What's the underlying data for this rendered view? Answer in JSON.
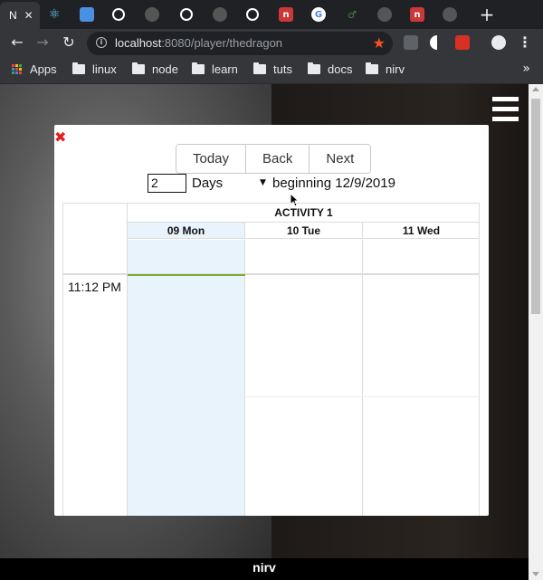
{
  "browser": {
    "tabs": [
      {
        "icon": "nirv-n-icon",
        "title": "N",
        "active": true,
        "color": "#ffffff"
      },
      {
        "icon": "react-icon",
        "color": "#61dafb"
      },
      {
        "icon": "calendar-app-icon",
        "color": "#4a90e2"
      },
      {
        "icon": "globe-icon",
        "color": "#ffffff"
      },
      {
        "icon": "github-icon",
        "color": "#888888"
      },
      {
        "icon": "globe-icon",
        "color": "#ffffff"
      },
      {
        "icon": "github-icon",
        "color": "#888888"
      },
      {
        "icon": "globe-icon",
        "color": "#ffffff"
      },
      {
        "icon": "npm-icon",
        "color": "#cb3837"
      },
      {
        "icon": "google-icon",
        "color": "#ffffff"
      },
      {
        "icon": "node-icon",
        "color": "#3c873a"
      },
      {
        "icon": "github-icon",
        "color": "#888888"
      },
      {
        "icon": "npm-icon",
        "color": "#cb3837"
      },
      {
        "icon": "github-icon",
        "color": "#888888"
      }
    ],
    "active_tab_label": "N",
    "url_host": "localhost",
    "url_rest": ":8080/player/thedragon",
    "bookmarks": {
      "apps": "Apps",
      "folders": [
        "linux",
        "node",
        "learn",
        "tuts",
        "docs",
        "nirv"
      ],
      "more": "»"
    }
  },
  "page": {
    "footer_text": "nirv"
  },
  "modal": {
    "buttons": {
      "today": "Today",
      "back": "Back",
      "next": "Next"
    },
    "range": {
      "count": "2",
      "unit": "Days",
      "beginning": "beginning 12/9/2019"
    },
    "calendar": {
      "resource_title": "ACTIVITY 1",
      "days": [
        "09 Mon",
        "10 Tue",
        "11 Wed"
      ],
      "time_label": "11:12 PM"
    }
  },
  "colors": {
    "today_column": "#e8f3fc",
    "now_indicator": "#74ad31",
    "close_icon": "#e02020"
  }
}
